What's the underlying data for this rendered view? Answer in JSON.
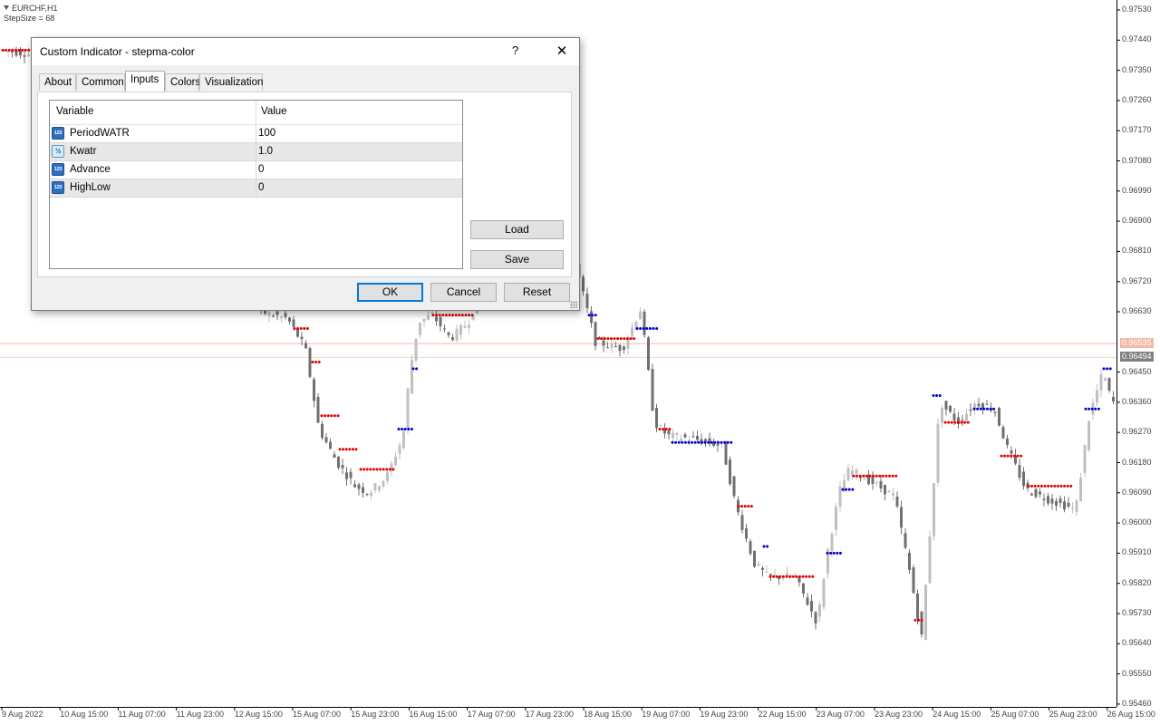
{
  "chart": {
    "symbol": "EURCHF,H1",
    "indicator_label": "StepSize = 68",
    "y_labels": [
      "0.97530",
      "0.97440",
      "0.97350",
      "0.97260",
      "0.97170",
      "0.97080",
      "0.96990",
      "0.96900",
      "0.96810",
      "0.96720",
      "0.96630",
      "0.96450",
      "0.96360",
      "0.96270",
      "0.96180",
      "0.96090",
      "0.96000",
      "0.95910",
      "0.95820",
      "0.95730",
      "0.95640",
      "0.95550",
      "0.95460"
    ],
    "ask_tag": "0.96535",
    "bid_tag": "0.96494",
    "x_labels": [
      "9 Aug 2022",
      "10 Aug 15:00",
      "11 Aug 07:00",
      "11 Aug 23:00",
      "12 Aug 15:00",
      "15 Aug 07:00",
      "15 Aug 23:00",
      "16 Aug 15:00",
      "17 Aug 07:00",
      "17 Aug 23:00",
      "18 Aug 15:00",
      "19 Aug 07:00",
      "19 Aug 23:00",
      "22 Aug 15:00",
      "23 Aug 07:00",
      "23 Aug 23:00",
      "24 Aug 15:00",
      "25 Aug 07:00",
      "25 Aug 23:00",
      "26 Aug 15:00"
    ],
    "colors": {
      "bull": "#c0c0c0",
      "bear": "#707070",
      "step_up": "#0000cc",
      "step_down": "#dd0000",
      "ask_line": "#f4b8a8",
      "bid_line": "#808080"
    }
  },
  "dialog": {
    "title": "Custom Indicator - stepma-color",
    "help": "?",
    "close": "✕",
    "tabs": [
      "About",
      "Common",
      "Inputs",
      "Colors",
      "Visualization"
    ],
    "active_tab": "Inputs",
    "grid": {
      "col_variable": "Variable",
      "col_value": "Value",
      "rows": [
        {
          "icon": "123",
          "variable": "PeriodWATR",
          "value": "100"
        },
        {
          "icon": "½",
          "variable": "Kwatr",
          "value": "1.0"
        },
        {
          "icon": "123",
          "variable": "Advance",
          "value": "0"
        },
        {
          "icon": "123",
          "variable": "HighLow",
          "value": "0"
        }
      ]
    },
    "load": "Load",
    "save": "Save",
    "ok": "OK",
    "cancel": "Cancel",
    "reset": "Reset"
  }
}
